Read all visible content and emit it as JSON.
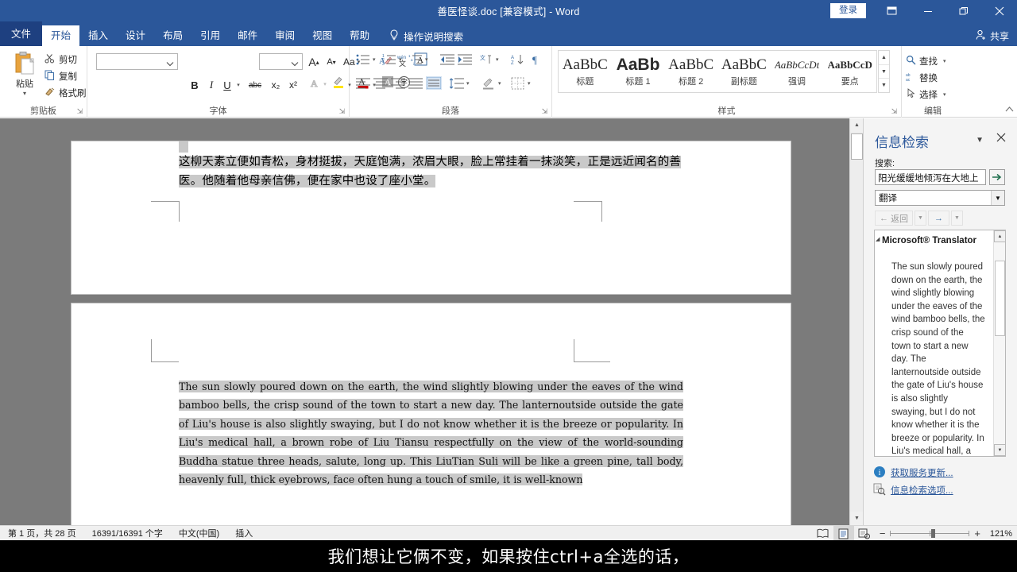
{
  "titlebar": {
    "document_title": "善医怪谈.doc [兼容模式]  -  Word",
    "signin_label": "登录",
    "ribbon_display_icon": "ribbon-display-options-icon",
    "minimize_icon": "minimize-icon",
    "restore_icon": "restore-icon",
    "close_icon": "close-icon"
  },
  "tabs": {
    "file": "文件",
    "items": [
      "开始",
      "插入",
      "设计",
      "布局",
      "引用",
      "邮件",
      "审阅",
      "视图",
      "帮助"
    ],
    "active": "开始",
    "tell_me": "操作说明搜索",
    "share": "共享"
  },
  "ribbon": {
    "clipboard": {
      "group_label": "剪贴板",
      "paste": "粘贴",
      "cut": "剪切",
      "copy": "复制",
      "format_painter": "格式刷"
    },
    "font": {
      "group_label": "字体",
      "font_name_value": "",
      "font_size_value": "",
      "grow_font": "A",
      "shrink_font": "A",
      "change_case": "Aa",
      "bold": "B",
      "italic": "I",
      "underline": "U",
      "strikethrough": "abc",
      "subscript": "x₂",
      "superscript": "x²"
    },
    "paragraph": {
      "group_label": "段落"
    },
    "styles": {
      "group_label": "样式",
      "items": [
        {
          "sample": "AaBbC",
          "name": "标题"
        },
        {
          "sample": "AaBb",
          "name": "标题 1"
        },
        {
          "sample": "AaBbC",
          "name": "标题 2"
        },
        {
          "sample": "AaBbC",
          "name": "副标题"
        },
        {
          "sample": "AaBbCcDt",
          "name": "强调"
        },
        {
          "sample": "AaBbCcD",
          "name": "要点"
        }
      ]
    },
    "editing": {
      "group_label": "编辑",
      "find": "查找",
      "replace": "替换",
      "select": "选择"
    }
  },
  "document": {
    "chinese_paragraph": "这柳天素立便如青松，身材挺拔，天庭饱满，浓眉大眼，脸上常挂着一抹淡笑，正是远近闻名的善医。他随着他母亲信佛，便在家中也设了座小堂。",
    "english_paragraph": "The sun slowly poured down on the earth, the wind slightly blowing under the eaves of the wind bamboo bells, the crisp sound of the town to start a new day.  The lanternoutside outside the gate of Liu's house is also slightly swaying, but I do not know whether it is the breeze or popularity.  In Liu's medical hall, a brown robe of Liu Tiansu respectfully on the view of the world-sounding Buddha statue three heads, salute, long up.  This LiuTian Suli will be like a green pine, tall body, heavenly full, thick eyebrows, face often hung a touch of smile, it is well-known"
  },
  "pane": {
    "title": "信息检索",
    "dropdown_icon": "chevron-down-icon",
    "close_icon": "close-icon",
    "search_label": "搜索:",
    "search_value": "阳光缓缓地倾泻在大地上",
    "go_icon": "go-arrow-icon",
    "service_value": "翻译",
    "back_label": "返回",
    "forward_icon": "forward-arrow-icon",
    "result_title": "Microsoft® Translator",
    "result_body": "The sun slowly poured down on the earth, the wind slightly blowing under the eaves of the wind bamboo bells, the crisp sound of the town to start a new day.  The lanternoutside outside the gate of Liu's house is also slightly swaying, but I do not know whether it is the breeze or popularity.  In Liu's medical hall, a brown robe of Liu Tiansu respectfully on the view",
    "link_updates": "获取服务更新...",
    "link_options": "信息检索选项...",
    "info_icon": "info-icon",
    "options_icon": "research-options-icon"
  },
  "status": {
    "page": "第 1 页，共 28 页",
    "words": "16391/16391 个字",
    "language": "中文(中国)",
    "mode": "插入",
    "view_read_icon": "read-mode-icon",
    "view_print_icon": "print-layout-icon",
    "view_web_icon": "web-layout-icon",
    "zoom_out": "−",
    "zoom_in": "+",
    "zoom_value": "121%"
  },
  "caption": {
    "text": "我们想让它俩不变，如果按住ctrl+a全选的话，"
  },
  "colors": {
    "word_blue": "#2b579a",
    "file_tab_blue": "#1e4080",
    "selection_gray": "#c9c9c9",
    "workspace_gray": "#7b7b7b",
    "link_blue": "#2a5699"
  }
}
